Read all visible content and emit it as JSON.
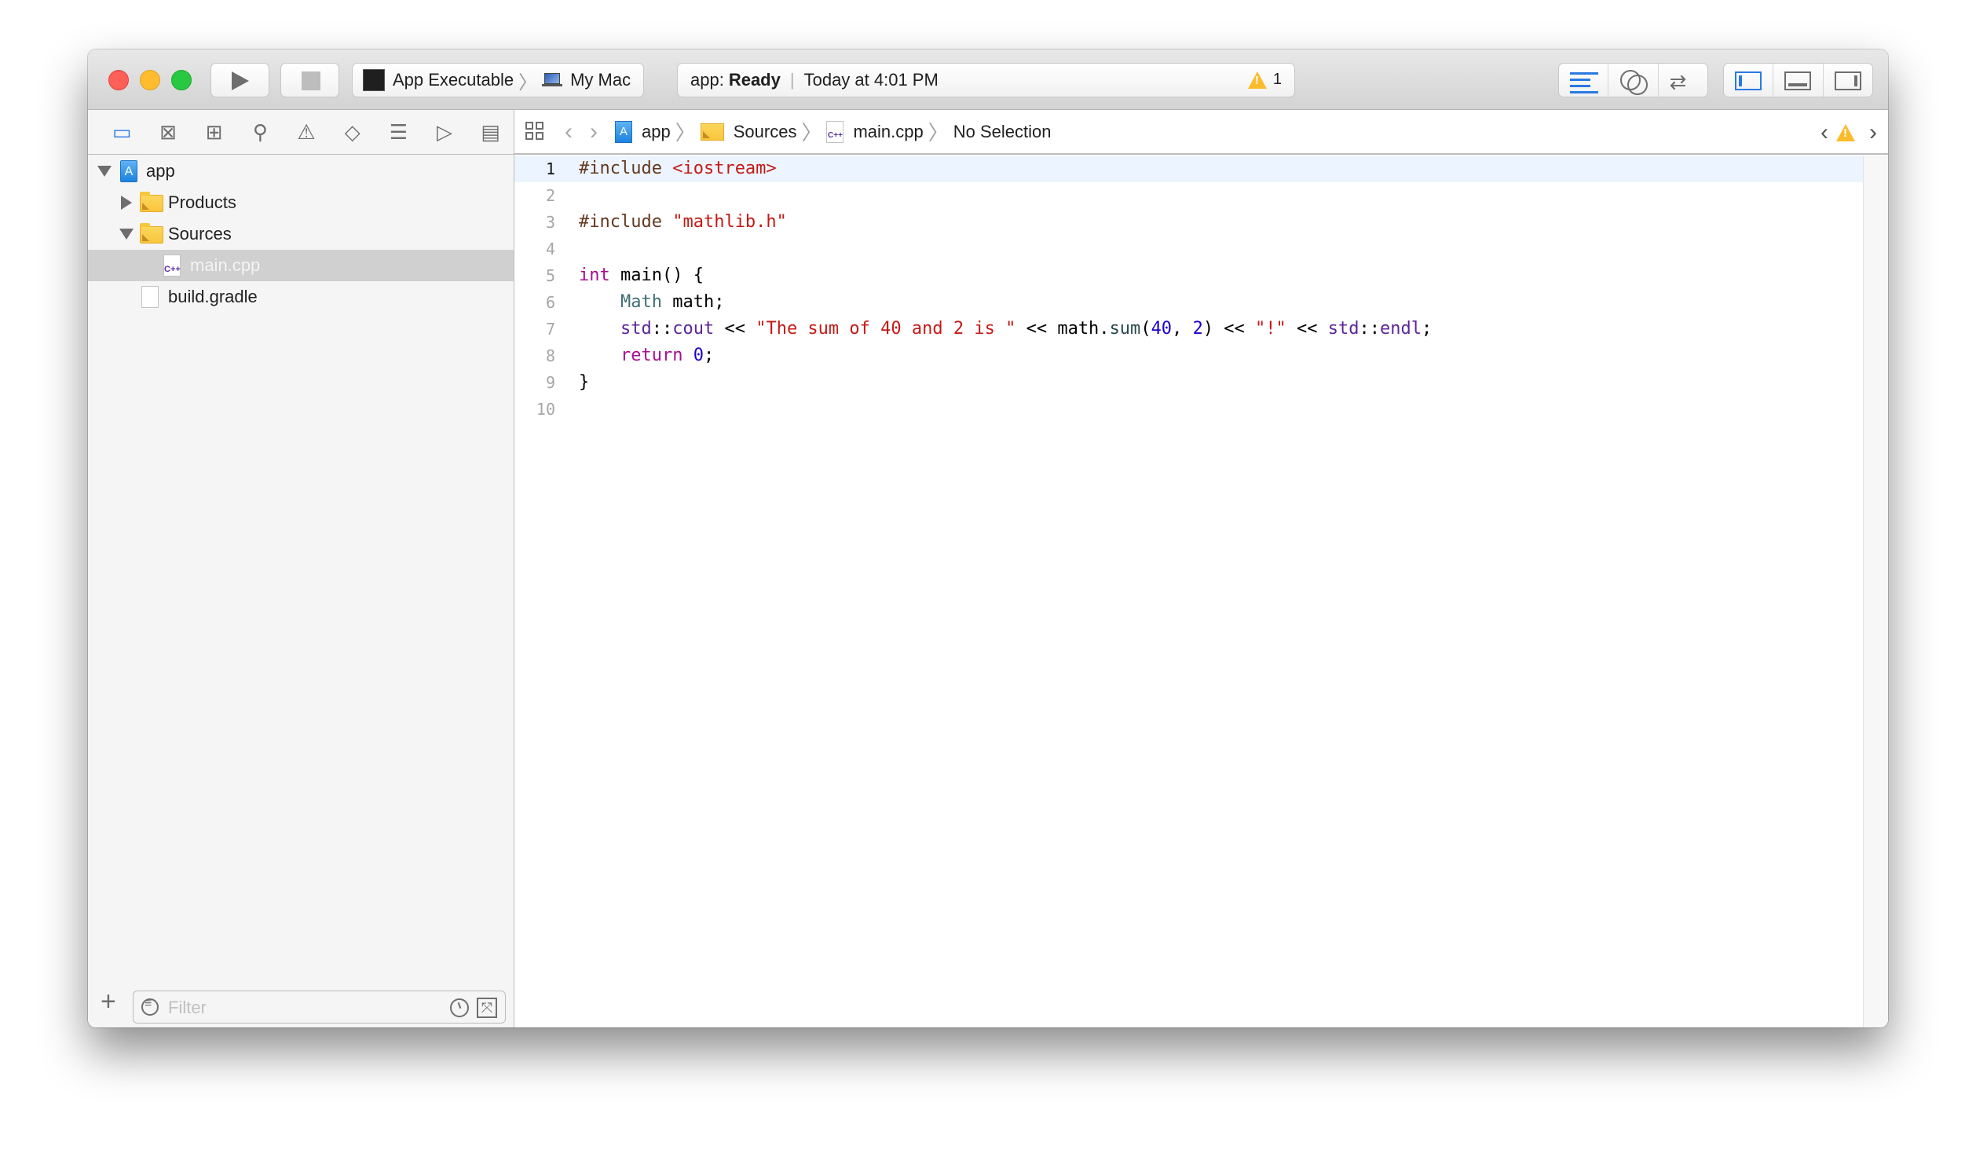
{
  "toolbar": {
    "run_label": "Run",
    "stop_label": "Stop",
    "scheme": {
      "target": "App Executable",
      "device": "My Mac"
    },
    "activity": {
      "project": "app:",
      "status": "Ready",
      "time": "Today at 4:01 PM",
      "warning_count": "1"
    },
    "editor_modes": [
      "standard-editor",
      "assistant-editor",
      "version-editor"
    ],
    "panels": [
      "navigator",
      "debug-area",
      "utilities"
    ]
  },
  "navigator": {
    "tabs": [
      "project",
      "source-control",
      "symbol",
      "find",
      "issue",
      "test",
      "debug",
      "breakpoint",
      "report"
    ],
    "tree": [
      {
        "label": "app",
        "type": "project",
        "level": 0,
        "expanded": true
      },
      {
        "label": "Products",
        "type": "folder",
        "level": 1,
        "expanded": false
      },
      {
        "label": "Sources",
        "type": "folder",
        "level": 1,
        "expanded": true
      },
      {
        "label": "main.cpp",
        "type": "cpp",
        "level": 2,
        "selected": true
      },
      {
        "label": "build.gradle",
        "type": "file",
        "level": 1
      }
    ],
    "filter_placeholder": "Filter",
    "add_label": "+"
  },
  "jumpbar": {
    "crumbs": [
      "app",
      "Sources",
      "main.cpp",
      "No Selection"
    ]
  },
  "editor": {
    "current_line": 1,
    "lines": [
      [
        {
          "t": "#include ",
          "c": "pp"
        },
        {
          "t": "<iostream>",
          "c": "str"
        }
      ],
      [],
      [
        {
          "t": "#include ",
          "c": "pp"
        },
        {
          "t": "\"mathlib.h\"",
          "c": "str"
        }
      ],
      [],
      [
        {
          "t": "int",
          "c": "kw"
        },
        {
          "t": " main() {",
          "c": ""
        }
      ],
      [
        {
          "t": "    ",
          "c": ""
        },
        {
          "t": "Math",
          "c": "ty"
        },
        {
          "t": " math;",
          "c": ""
        }
      ],
      [
        {
          "t": "    ",
          "c": ""
        },
        {
          "t": "std",
          "c": "ns"
        },
        {
          "t": "::",
          "c": ""
        },
        {
          "t": "cout",
          "c": "ns"
        },
        {
          "t": " << ",
          "c": ""
        },
        {
          "t": "\"The sum of 40 and 2 is \"",
          "c": "str"
        },
        {
          "t": " << math.",
          "c": ""
        },
        {
          "t": "sum",
          "c": "fn"
        },
        {
          "t": "(",
          "c": ""
        },
        {
          "t": "40",
          "c": "num"
        },
        {
          "t": ", ",
          "c": ""
        },
        {
          "t": "2",
          "c": "num"
        },
        {
          "t": ") << ",
          "c": ""
        },
        {
          "t": "\"!\"",
          "c": "str"
        },
        {
          "t": " << ",
          "c": ""
        },
        {
          "t": "std",
          "c": "ns"
        },
        {
          "t": "::",
          "c": ""
        },
        {
          "t": "endl",
          "c": "ns"
        },
        {
          "t": ";",
          "c": ""
        }
      ],
      [
        {
          "t": "    ",
          "c": ""
        },
        {
          "t": "return",
          "c": "kw"
        },
        {
          "t": " ",
          "c": ""
        },
        {
          "t": "0",
          "c": "num"
        },
        {
          "t": ";",
          "c": ""
        }
      ],
      [
        {
          "t": "}",
          "c": ""
        }
      ],
      []
    ]
  }
}
